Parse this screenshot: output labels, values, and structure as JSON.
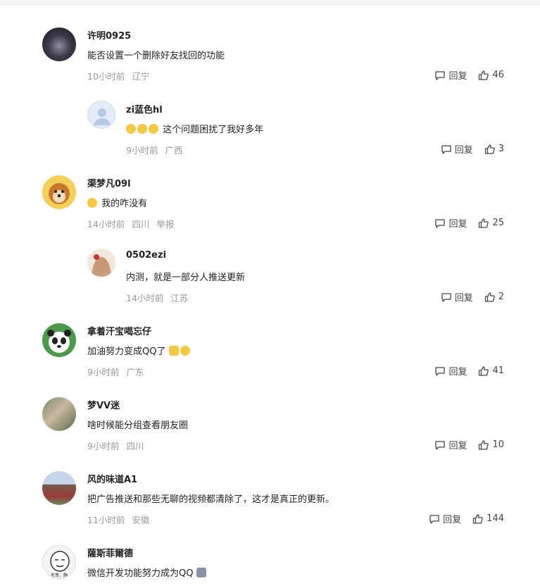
{
  "comments": [
    {
      "user": "许明0925",
      "text": "能否设置一个删除好友找回的功能",
      "time": "10小时前",
      "loc": "辽宁",
      "report": "",
      "likes": "46"
    },
    {
      "user": "zi蓝色hl",
      "text": "这个问题困扰了我好多年",
      "time": "9小时前",
      "loc": "广西",
      "report": "",
      "likes": "3"
    },
    {
      "user": "渠梦凡09l",
      "text": "我的咋没有",
      "time": "14小时前",
      "loc": "四川",
      "report": "举报",
      "likes": "25"
    },
    {
      "user": "0502ezi",
      "text": "内测，就是一部分人推送更新",
      "time": "14小时前",
      "loc": "江苏",
      "report": "",
      "likes": "2"
    },
    {
      "user": "拿着汗宝喝忘仔",
      "text": "加油努力变成QQ了",
      "time": "9小时前",
      "loc": "广东",
      "report": "",
      "likes": "41"
    },
    {
      "user": "梦VV迷",
      "text": "啥时候能分组查看朋友圈",
      "time": "9小时前",
      "loc": "四川",
      "report": "",
      "likes": "10"
    },
    {
      "user": "风的味道A1",
      "text": "把广告推送和那些无聊的视频都清除了，这才是真正的更新。",
      "time": "11小时前",
      "loc": "安徽",
      "report": "",
      "likes": "144"
    },
    {
      "user": "薩斯菲爾德",
      "text": "微信开发功能努力成为QQ",
      "time": "",
      "loc": "",
      "report": "",
      "likes": ""
    }
  ],
  "reply_label": "回复",
  "avatar_text": "老哥，静",
  "colors": {
    "meta": "#999999",
    "text": "#222222"
  }
}
